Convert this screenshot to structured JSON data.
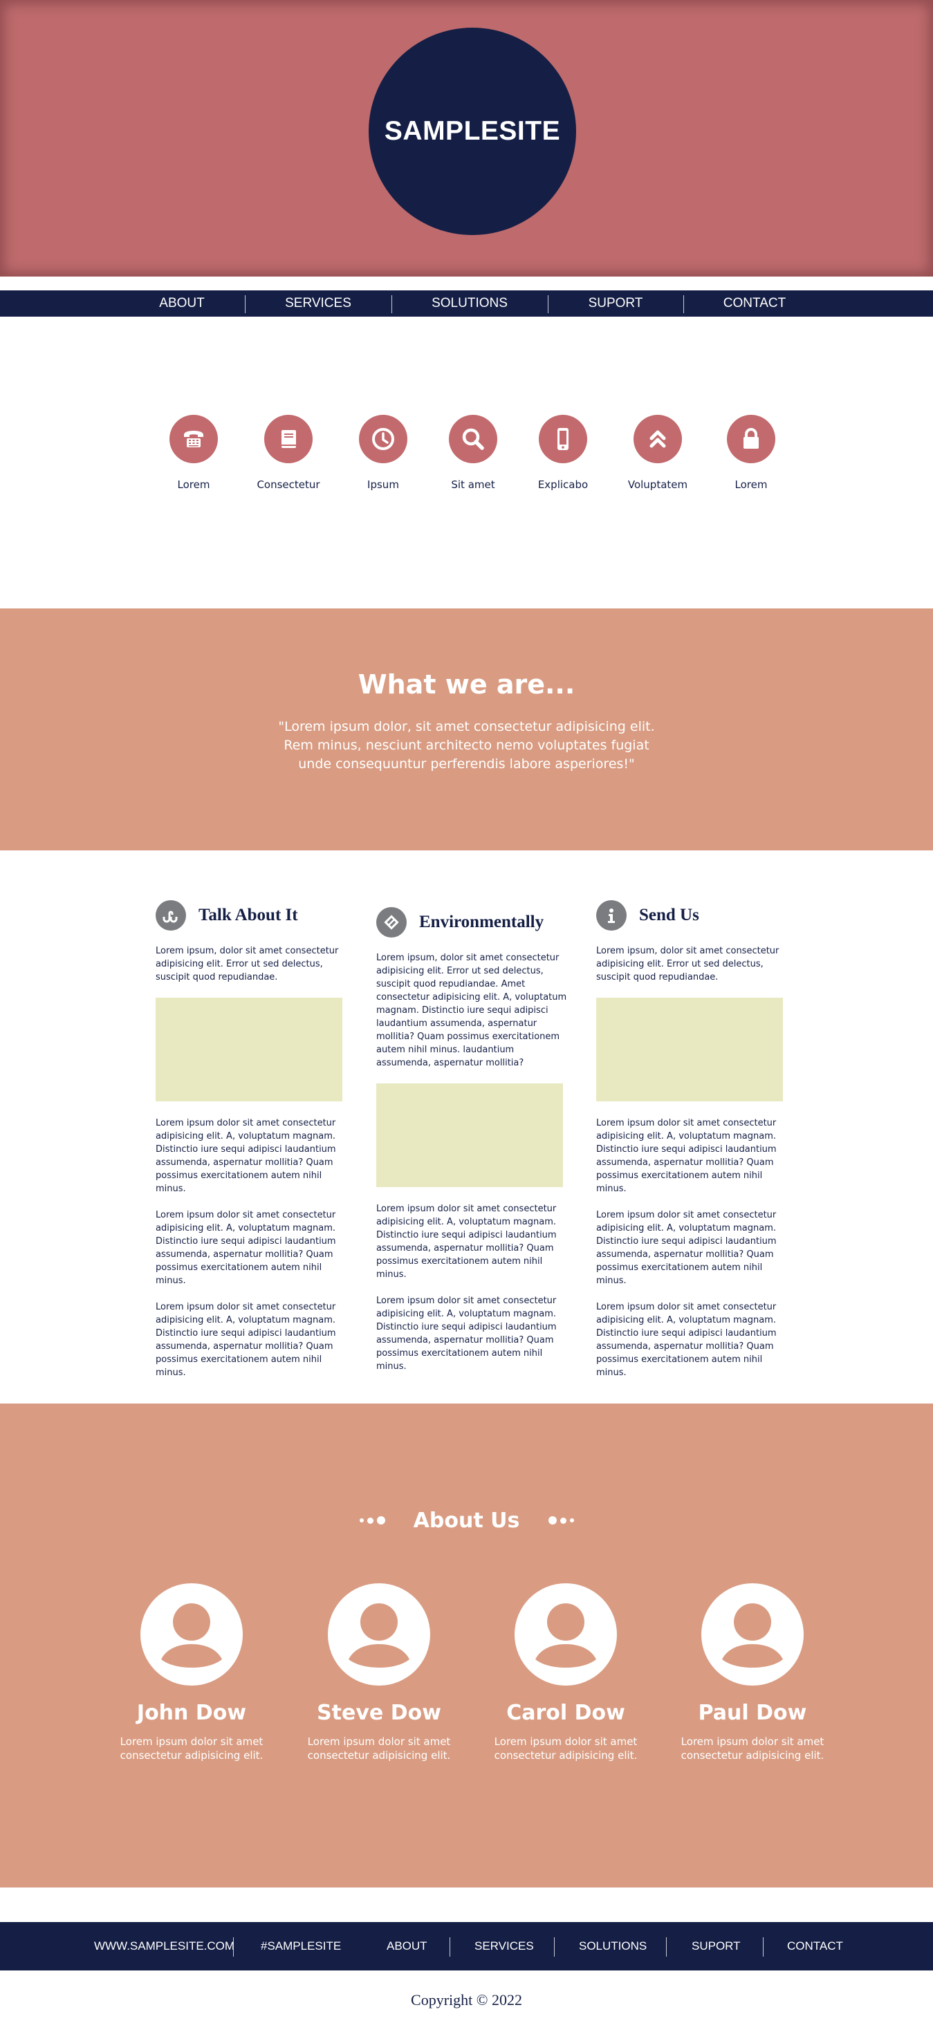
{
  "header": {
    "logo": "SAMPLESITE"
  },
  "nav": {
    "items": [
      "ABOUT",
      "SERVICES",
      "SOLUTIONS",
      "SUPORT",
      "CONTACT"
    ]
  },
  "features": [
    {
      "label": "Lorem",
      "icon": "phone-icon"
    },
    {
      "label": "Consectetur",
      "icon": "book-icon"
    },
    {
      "label": "Ipsum",
      "icon": "clock-icon"
    },
    {
      "label": "Sit amet",
      "icon": "search-icon"
    },
    {
      "label": "Explicabo",
      "icon": "mobile-icon"
    },
    {
      "label": "Voluptatem",
      "icon": "chevrons-up-icon"
    },
    {
      "label": "Lorem",
      "icon": "lock-icon"
    }
  ],
  "what": {
    "title": "What we are...",
    "text": "\"Lorem ipsum dolor, sit amet consectetur adipisicing elit. Rem minus, nesciunt architecto nemo voluptates fugiat unde consequuntur perferendis labore asperiores!\""
  },
  "columns": [
    {
      "title": "Talk About It",
      "icon": "stumbleupon-icon",
      "intro": "Lorem ipsum, dolor sit amet consectetur adipisicing elit. Error ut sed delectus, suscipit quod repudiandae.",
      "paras": [
        "Lorem ipsum dolor sit amet consectetur adipisicing elit. A, voluptatum magnam. Distinctio iure sequi adipisci laudantium assumenda, aspernatur mollitia? Quam possimus exercitationem autem nihil minus.",
        "Lorem ipsum dolor sit amet consectetur adipisicing elit. A, voluptatum magnam. Distinctio iure sequi adipisci laudantium assumenda, aspernatur mollitia? Quam possimus exercitationem autem nihil minus.",
        "Lorem ipsum dolor sit amet consectetur adipisicing elit. A, voluptatum magnam. Distinctio iure sequi adipisci laudantium assumenda, aspernatur mollitia? Quam possimus exercitationem autem nihil minus."
      ]
    },
    {
      "title": "Environmentally",
      "icon": "diamond-link-icon",
      "intro": "Lorem ipsum, dolor sit amet consectetur adipisicing elit. Error ut sed delectus, suscipit quod repudiandae. Amet consectetur adipisicing elit. A, voluptatum magnam. Distinctio iure sequi adipisci laudantium assumenda, aspernatur mollitia? Quam possimus exercitationem autem nihil minus. laudantium assumenda, aspernatur mollitia?",
      "paras": [
        "Lorem ipsum dolor sit amet consectetur adipisicing elit. A, voluptatum magnam. Distinctio iure sequi adipisci laudantium assumenda, aspernatur mollitia? Quam possimus exercitationem autem nihil minus.",
        "Lorem ipsum dolor sit amet consectetur adipisicing elit. A, voluptatum magnam. Distinctio iure sequi adipisci laudantium assumenda, aspernatur mollitia? Quam possimus exercitationem autem nihil minus."
      ]
    },
    {
      "title": "Send Us",
      "icon": "info-icon",
      "intro": "Lorem ipsum, dolor sit amet consectetur adipisicing elit. Error ut sed delectus, suscipit quod repudiandae.",
      "paras": [
        "Lorem ipsum dolor sit amet consectetur adipisicing elit. A, voluptatum magnam. Distinctio iure sequi adipisci laudantium assumenda, aspernatur mollitia? Quam possimus exercitationem autem nihil minus.",
        "Lorem ipsum dolor sit amet consectetur adipisicing elit. A, voluptatum magnam. Distinctio iure sequi adipisci laudantium assumenda, aspernatur mollitia? Quam possimus exercitationem autem nihil minus.",
        "Lorem ipsum dolor sit amet consectetur adipisicing elit. A, voluptatum magnam. Distinctio iure sequi adipisci laudantium assumenda, aspernatur mollitia? Quam possimus exercitationem autem nihil minus."
      ]
    }
  ],
  "about": {
    "title": "About Us",
    "members": [
      {
        "name": "John Dow",
        "text": "Lorem ipsum dolor sit amet consectetur adipisicing elit."
      },
      {
        "name": "Steve Dow",
        "text": "Lorem ipsum dolor sit amet consectetur adipisicing elit."
      },
      {
        "name": "Carol Dow",
        "text": "Lorem ipsum dolor sit amet consectetur adipisicing elit."
      },
      {
        "name": "Paul Dow",
        "text": "Lorem ipsum dolor sit amet consectetur adipisicing elit."
      }
    ]
  },
  "footer": {
    "site": "WWW.SAMPLESITE.COM",
    "hashtag": "#SAMPLESITE",
    "nav": [
      "ABOUT",
      "SERVICES",
      "SOLUTIONS",
      "SUPORT",
      "CONTACT"
    ],
    "copyright": "Copyright © 2022"
  },
  "colors": {
    "navy": "#151f45",
    "rose": "#bf6b6e",
    "salmon": "#d99c82",
    "placeholder": "#e8e9c0",
    "icon_grey": "#7b7c80"
  }
}
